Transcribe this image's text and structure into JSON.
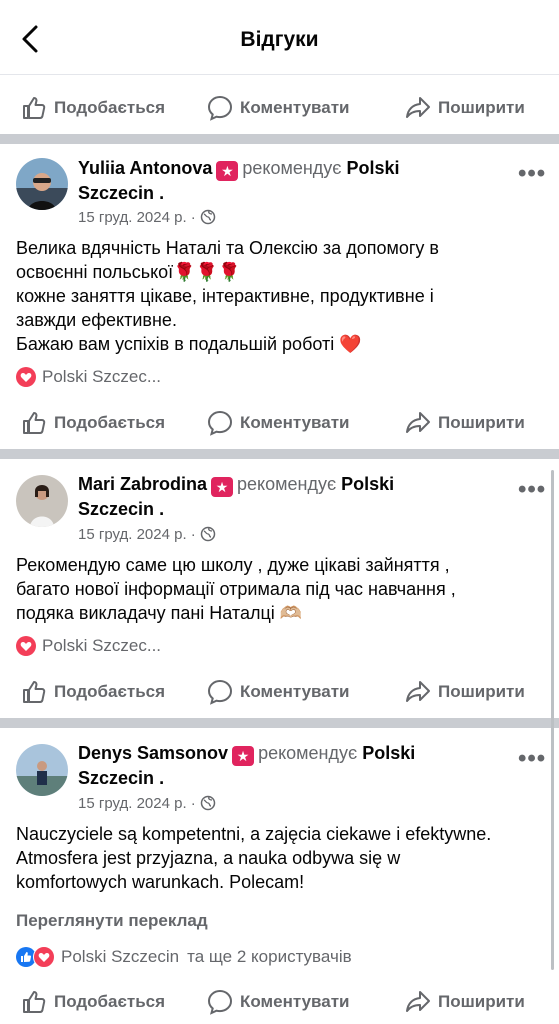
{
  "header": {
    "title": "Відгуки"
  },
  "actions": {
    "like": "Подобається",
    "comment": "Коментувати",
    "share": "Поширити"
  },
  "posts": [
    {
      "name": "Yuliia Antonova",
      "recommends": "рекомендує",
      "page": "Polski",
      "page2": "Szczecin",
      "date": "15 груд. 2024 р. ·",
      "lines": [
        "Велика вдячність Наталі та Олексію за допомогу в",
        "освоєнні польської🌹🌹🌹",
        "кожне заняття цікаве, інтерактивне, продуктивне і",
        "завжди ефективне.",
        "Бажаю вам успіхів в подальшій роботі ❤️"
      ],
      "reactions": "Polski Szczec..."
    },
    {
      "name": "Mari Zabrodina",
      "recommends": "рекомендує",
      "page": "Polski",
      "page2": "Szczecin",
      "date": "15 груд. 2024 р. ·",
      "lines": [
        "Рекомендую саме цю школу , дуже цікаві зайняття ,",
        "багато нової інформації отримала під час навчання ,",
        "подяка викладачу пані Наталці 🫶🏼"
      ],
      "reactions": "Polski Szczec..."
    },
    {
      "name": "Denys Samsonov",
      "recommends": "рекомендує",
      "page": "Polski",
      "page2": "Szczecin",
      "date": "15 груд. 2024 р. ·",
      "lines": [
        "Nauczyciele są kompetentni, a zajęcia ciekawe i efektywne.",
        "Atmosfera jest przyjazna, a nauka odbywa się w",
        "komfortowych warunkach. Polecam!"
      ],
      "translate": "Переглянути переклад",
      "reactions": "Polski Szczecin",
      "reactions_extra": "та ще 2 користувачів"
    }
  ],
  "icons": {
    "back": "chevron-left-icon",
    "like": "thumbs-up-icon",
    "comment": "comment-bubble-icon",
    "share": "share-arrow-icon",
    "more": "more-dots-icon",
    "globe": "globe-icon",
    "recommend": "star-badge-icon"
  }
}
